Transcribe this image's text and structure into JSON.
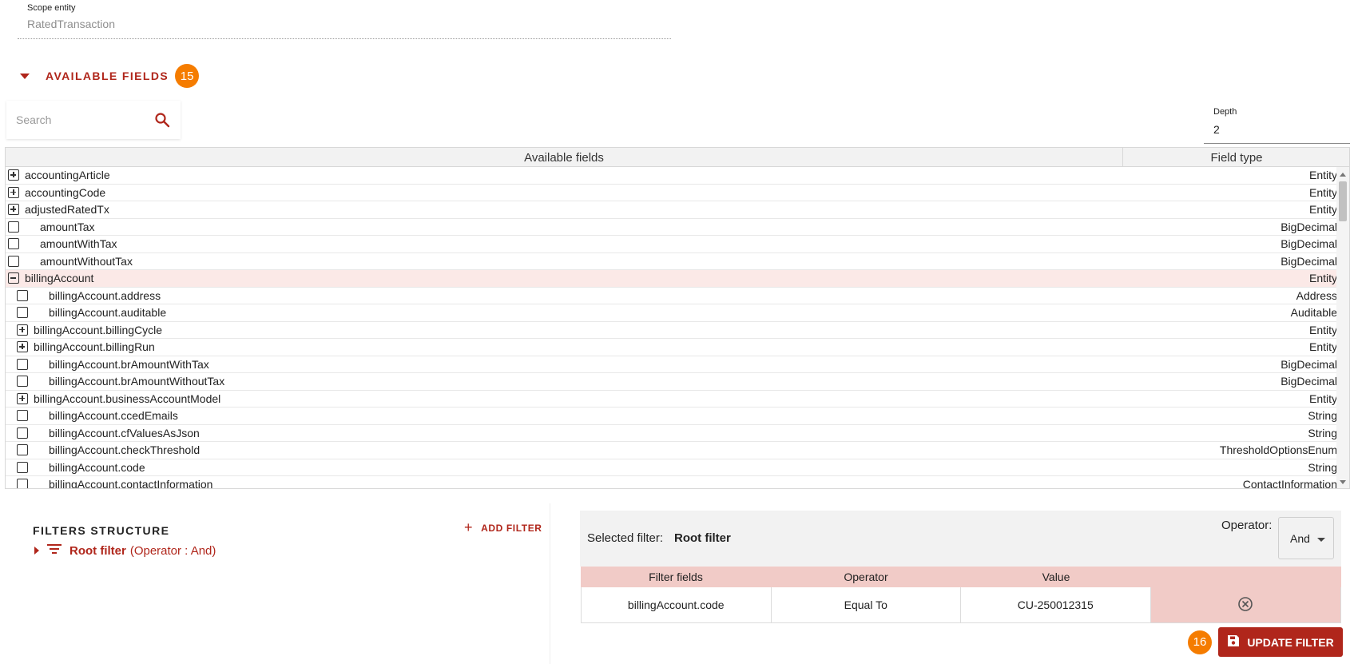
{
  "scope": {
    "label": "Scope entity",
    "value": "RatedTransaction"
  },
  "available_fields": {
    "title": "AVAILABLE FIELDS",
    "badge": "15"
  },
  "search": {
    "placeholder": "Search"
  },
  "depth": {
    "label": "Depth",
    "value": "2"
  },
  "table": {
    "col_fields": "Available fields",
    "col_type": "Field type",
    "rows": [
      {
        "name": "accountingArticle",
        "type": "Entity",
        "ctrl": "expand",
        "indent": 0
      },
      {
        "name": "accountingCode",
        "type": "Entity",
        "ctrl": "expand",
        "indent": 0
      },
      {
        "name": "adjustedRatedTx",
        "type": "Entity",
        "ctrl": "expand",
        "indent": 0
      },
      {
        "name": "amountTax",
        "type": "BigDecimal",
        "ctrl": "check",
        "indent": 0
      },
      {
        "name": "amountWithTax",
        "type": "BigDecimal",
        "ctrl": "check",
        "indent": 0
      },
      {
        "name": "amountWithoutTax",
        "type": "BigDecimal",
        "ctrl": "check",
        "indent": 0
      },
      {
        "name": "billingAccount",
        "type": "Entity",
        "ctrl": "collapse",
        "indent": 0,
        "selected": true
      },
      {
        "name": "billingAccount.address",
        "type": "Address",
        "ctrl": "check",
        "indent": 1
      },
      {
        "name": "billingAccount.auditable",
        "type": "Auditable",
        "ctrl": "check",
        "indent": 1
      },
      {
        "name": "billingAccount.billingCycle",
        "type": "Entity",
        "ctrl": "expand",
        "indent": 1
      },
      {
        "name": "billingAccount.billingRun",
        "type": "Entity",
        "ctrl": "expand",
        "indent": 1
      },
      {
        "name": "billingAccount.brAmountWithTax",
        "type": "BigDecimal",
        "ctrl": "check",
        "indent": 1
      },
      {
        "name": "billingAccount.brAmountWithoutTax",
        "type": "BigDecimal",
        "ctrl": "check",
        "indent": 1
      },
      {
        "name": "billingAccount.businessAccountModel",
        "type": "Entity",
        "ctrl": "expand",
        "indent": 1
      },
      {
        "name": "billingAccount.ccedEmails",
        "type": "String",
        "ctrl": "check",
        "indent": 1
      },
      {
        "name": "billingAccount.cfValuesAsJson",
        "type": "String",
        "ctrl": "check",
        "indent": 1
      },
      {
        "name": "billingAccount.checkThreshold",
        "type": "ThresholdOptionsEnum",
        "ctrl": "check",
        "indent": 1
      },
      {
        "name": "billingAccount.code",
        "type": "String",
        "ctrl": "check",
        "indent": 1
      },
      {
        "name": "billingAccount.contactInformation",
        "type": "ContactInformation",
        "ctrl": "check",
        "indent": 1
      }
    ]
  },
  "filters": {
    "title": "FILTERS STRUCTURE",
    "add_label": "ADD FILTER",
    "root_name": "Root filter",
    "root_operator": "(Operator : And)"
  },
  "selected_filter": {
    "label": "Selected filter:",
    "name": "Root filter",
    "operator_label": "Operator:",
    "operator_value": "And",
    "columns": [
      "Filter fields",
      "Operator",
      "Value"
    ],
    "row": {
      "field": "billingAccount.code",
      "operator": "Equal To",
      "value": "CU-250012315"
    }
  },
  "update": {
    "badge": "16",
    "label": "UPDATE FILTER"
  },
  "colors": {
    "accent": "#b0261b",
    "badge": "#f57c00",
    "selected_row": "#fbe9e7",
    "filter_header": "#f1cbc7"
  }
}
